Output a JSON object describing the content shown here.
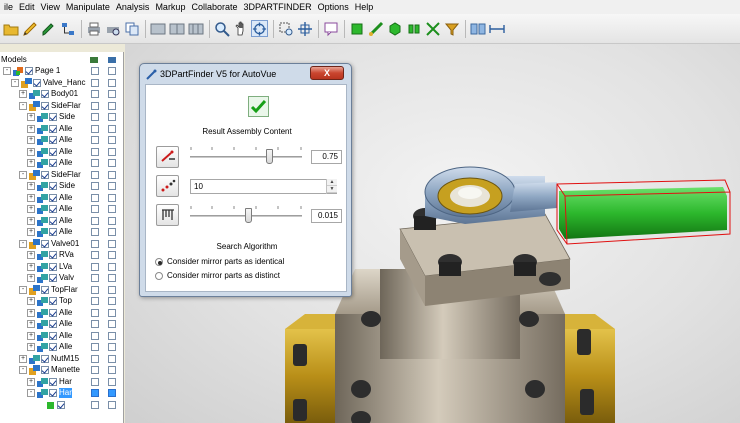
{
  "menu": [
    "ile",
    "Edit",
    "View",
    "Manipulate",
    "Analysis",
    "Markup",
    "Collaborate",
    "3DPARTFINDER",
    "Options",
    "Help"
  ],
  "models_panel": {
    "title": "Models",
    "tree": [
      {
        "label": "Page 1",
        "indent": 0,
        "expander": "-",
        "icon": "page",
        "checked": true
      },
      {
        "label": "Valve_Hanc",
        "indent": 1,
        "expander": "-",
        "icon": "assembly",
        "checked": true
      },
      {
        "label": "Body01",
        "indent": 2,
        "expander": "+",
        "icon": "part",
        "checked": true
      },
      {
        "label": "SideFlar",
        "indent": 2,
        "expander": "-",
        "icon": "assembly",
        "checked": true
      },
      {
        "label": "Side",
        "indent": 3,
        "expander": "+",
        "icon": "part",
        "checked": true
      },
      {
        "label": "Alle",
        "indent": 3,
        "expander": "+",
        "icon": "part",
        "checked": true
      },
      {
        "label": "Alle",
        "indent": 3,
        "expander": "+",
        "icon": "part",
        "checked": true
      },
      {
        "label": "Alle",
        "indent": 3,
        "expander": "+",
        "icon": "part",
        "checked": true
      },
      {
        "label": "Alle",
        "indent": 3,
        "expander": "+",
        "icon": "part",
        "checked": true
      },
      {
        "label": "SideFlar",
        "indent": 2,
        "expander": "-",
        "icon": "assembly",
        "checked": true
      },
      {
        "label": "Side",
        "indent": 3,
        "expander": "+",
        "icon": "part",
        "checked": true
      },
      {
        "label": "Alle",
        "indent": 3,
        "expander": "+",
        "icon": "part",
        "checked": true
      },
      {
        "label": "Alle",
        "indent": 3,
        "expander": "+",
        "icon": "part",
        "checked": true
      },
      {
        "label": "Alle",
        "indent": 3,
        "expander": "+",
        "icon": "part",
        "checked": true
      },
      {
        "label": "Alle",
        "indent": 3,
        "expander": "+",
        "icon": "part",
        "checked": true
      },
      {
        "label": "Valve01",
        "indent": 2,
        "expander": "-",
        "icon": "assembly",
        "checked": true
      },
      {
        "label": "RVa",
        "indent": 3,
        "expander": "+",
        "icon": "part",
        "checked": true
      },
      {
        "label": "LVa",
        "indent": 3,
        "expander": "+",
        "icon": "part",
        "checked": true
      },
      {
        "label": "Valv",
        "indent": 3,
        "expander": "+",
        "icon": "part",
        "checked": true
      },
      {
        "label": "TopFlar",
        "indent": 2,
        "expander": "-",
        "icon": "assembly",
        "checked": true
      },
      {
        "label": "Top",
        "indent": 3,
        "expander": "+",
        "icon": "part",
        "checked": true
      },
      {
        "label": "Alle",
        "indent": 3,
        "expander": "+",
        "icon": "part",
        "checked": true
      },
      {
        "label": "Alle",
        "indent": 3,
        "expander": "+",
        "icon": "part",
        "checked": true
      },
      {
        "label": "Alle",
        "indent": 3,
        "expander": "+",
        "icon": "part",
        "checked": true
      },
      {
        "label": "Alle",
        "indent": 3,
        "expander": "+",
        "icon": "part",
        "checked": true
      },
      {
        "label": "NutM15",
        "indent": 2,
        "expander": "+",
        "icon": "part",
        "checked": true
      },
      {
        "label": "Manette",
        "indent": 2,
        "expander": "-",
        "icon": "assembly",
        "checked": true
      },
      {
        "label": "Har",
        "indent": 3,
        "expander": "+",
        "icon": "part",
        "checked": true
      },
      {
        "label": "Har",
        "indent": 3,
        "expander": "-",
        "icon": "part",
        "checked": true,
        "highlighted": true
      },
      {
        "label": "",
        "indent": 4,
        "expander": "",
        "icon": "leaf",
        "checked": true
      }
    ]
  },
  "dialog": {
    "title": "3DPartFinder V5 for AutoVue",
    "close_label": "X",
    "result_label": "Result Assembly Content",
    "slider1": {
      "value_text": "0.75",
      "position": 0.72
    },
    "count_value": "10",
    "slider2": {
      "value_text": "0.015",
      "position": 0.52
    },
    "algorithm_label": "Search Algorithm",
    "options": [
      {
        "label": "Consider mirror parts as identical",
        "selected": true
      },
      {
        "label": "Consider mirror parts as distinct",
        "selected": false
      }
    ]
  },
  "colors": {
    "selection": "#3399ff",
    "handle_green": "#2db82d",
    "brass": "#c9a227",
    "selection_box": "#e01010"
  }
}
